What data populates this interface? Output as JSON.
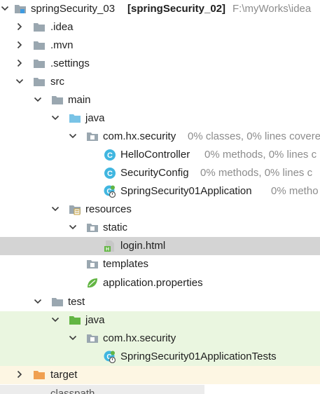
{
  "tree": {
    "root": {
      "name": "springSecurity_03",
      "module": "[springSecurity_02]",
      "path": "F:\\myWorks\\idea"
    },
    "idea": ".idea",
    "mvn": ".mvn",
    "settings": ".settings",
    "src": "src",
    "main": "main",
    "main_java": "java",
    "main_package": {
      "name": "com.hx.security",
      "coverage": "0% classes, 0% lines covere"
    },
    "hello_controller": {
      "name": "HelloController",
      "coverage": "0% methods, 0% lines c"
    },
    "security_config": {
      "name": "SecurityConfig",
      "coverage": "0% methods, 0% lines c"
    },
    "app_class": {
      "name": "SpringSecurity01Application",
      "coverage": "0% metho"
    },
    "resources": "resources",
    "static": "static",
    "login": "login.html",
    "templates": "templates",
    "app_props": "application.properties",
    "test": "test",
    "test_java": "java",
    "test_package": "com.hx.security",
    "test_class": "SpringSecurity01ApplicationTests",
    "target": "target",
    "classpath": "classpath"
  },
  "colors": {
    "selection": "#d4d4d4",
    "test_bg": "#eaf6e0",
    "target_bg": "#fdf6e3",
    "folder": "#9aa7b0",
    "source_folder": "#79c3e6",
    "test_folder": "#62b543",
    "excluded_folder": "#f0a050",
    "class_icon": "#40b6e0",
    "coverage_text": "#8c8c8c"
  },
  "icons": [
    "module-icon",
    "folder-icon",
    "source-folder-icon",
    "resources-folder-icon",
    "test-folder-icon",
    "excluded-folder-icon",
    "package-icon",
    "class-icon",
    "spring-boot-class-icon",
    "html-file-icon",
    "spring-properties-icon"
  ]
}
